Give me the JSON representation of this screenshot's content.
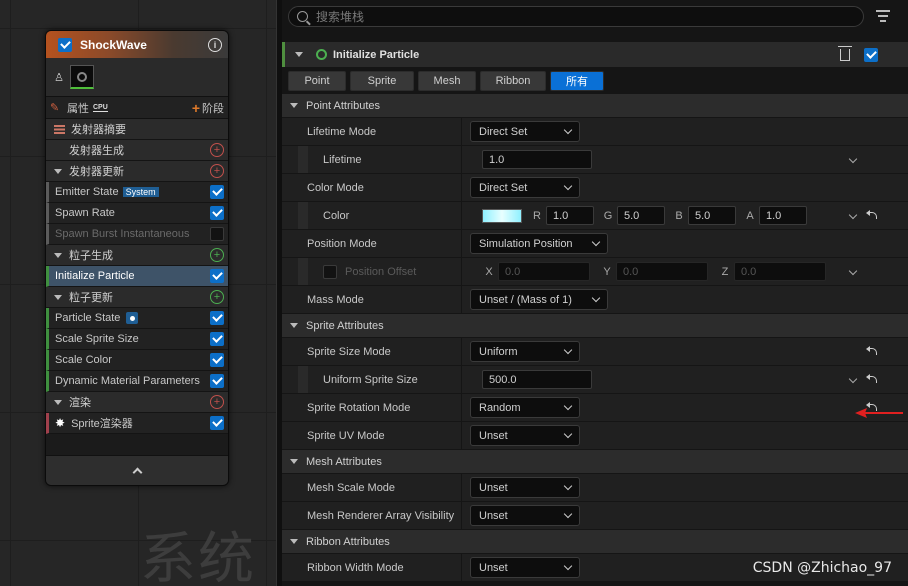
{
  "graph": {
    "watermark": "系统"
  },
  "node": {
    "title": "ShockWave",
    "tabs": {
      "properties_label": "属性",
      "cpu_badge": "CPU",
      "stage_label": "阶段"
    },
    "rows": [
      {
        "type": "section",
        "label": "发射器摘要",
        "icon": "list-icon"
      },
      {
        "type": "section-plus",
        "label": "发射器生成",
        "plus": "red"
      },
      {
        "type": "section-plus",
        "label": "发射器更新",
        "plus": "red",
        "collapsible": true
      },
      {
        "type": "item",
        "label": "Emitter State",
        "badge": "System",
        "checked": true,
        "bar": "gray"
      },
      {
        "type": "item",
        "label": "Spawn Rate",
        "checked": true,
        "bar": "gray"
      },
      {
        "type": "item",
        "label": "Spawn Burst Instantaneous",
        "checked": false,
        "bar": "gray",
        "dim": true
      },
      {
        "type": "section-plus",
        "label": "粒子生成",
        "plus": "green",
        "collapsible": true
      },
      {
        "type": "item",
        "label": "Initialize Particle",
        "checked": true,
        "bar": "green",
        "selected": true
      },
      {
        "type": "section-plus",
        "label": "粒子更新",
        "plus": "green",
        "collapsible": true
      },
      {
        "type": "item",
        "label": "Particle State",
        "dotbadge": true,
        "checked": true,
        "bar": "green"
      },
      {
        "type": "item",
        "label": "Scale Sprite Size",
        "checked": true,
        "bar": "green"
      },
      {
        "type": "item",
        "label": "Scale Color",
        "checked": true,
        "bar": "green"
      },
      {
        "type": "item",
        "label": "Dynamic Material Parameters",
        "checked": true,
        "bar": "green"
      },
      {
        "type": "section-plus",
        "label": "渲染",
        "plus": "red",
        "collapsible": true
      },
      {
        "type": "item",
        "label": "Sprite渲染器",
        "burst": true,
        "checked": true,
        "bar": "red"
      }
    ]
  },
  "panel": {
    "search_placeholder": "搜索堆栈",
    "module_title": "Initialize Particle",
    "tabs": [
      "Point",
      "Sprite",
      "Mesh",
      "Ribbon",
      "所有"
    ],
    "active_tab": 4,
    "rows": [
      {
        "kind": "cat",
        "label": "Point Attributes"
      },
      {
        "kind": "combo",
        "label": "Lifetime Mode",
        "value": "Direct Set",
        "w": 110
      },
      {
        "kind": "num",
        "label": "Lifetime",
        "value": "1.0",
        "sub": true,
        "expand": true
      },
      {
        "kind": "combo",
        "label": "Color Mode",
        "value": "Direct Set",
        "w": 110
      },
      {
        "kind": "color",
        "label": "Color",
        "sub": true,
        "expand": true,
        "reset": true,
        "channels": [
          {
            "k": "R",
            "v": "1.0"
          },
          {
            "k": "G",
            "v": "5.0"
          },
          {
            "k": "B",
            "v": "5.0"
          },
          {
            "k": "A",
            "v": "1.0"
          }
        ]
      },
      {
        "kind": "combo",
        "label": "Position Mode",
        "value": "Simulation Position",
        "w": 138
      },
      {
        "kind": "vec",
        "label": "Position Offset",
        "sub": true,
        "dim": true,
        "check": true,
        "expand": true,
        "channels": [
          {
            "k": "X",
            "v": "0.0"
          },
          {
            "k": "Y",
            "v": "0.0"
          },
          {
            "k": "Z",
            "v": "0.0"
          }
        ]
      },
      {
        "kind": "combo",
        "label": "Mass Mode",
        "value": "Unset / (Mass of 1)",
        "w": 138
      },
      {
        "kind": "cat",
        "label": "Sprite Attributes"
      },
      {
        "kind": "combo",
        "label": "Sprite Size Mode",
        "value": "Uniform",
        "w": 110,
        "reset": true
      },
      {
        "kind": "num",
        "label": "Uniform Sprite Size",
        "value": "500.0",
        "sub": true,
        "expand": true,
        "reset": true
      },
      {
        "kind": "combo",
        "label": "Sprite Rotation Mode",
        "value": "Random",
        "w": 110,
        "reset": true
      },
      {
        "kind": "combo",
        "label": "Sprite UV Mode",
        "value": "Unset",
        "w": 110
      },
      {
        "kind": "cat",
        "label": "Mesh Attributes"
      },
      {
        "kind": "combo",
        "label": "Mesh Scale Mode",
        "value": "Unset",
        "w": 110
      },
      {
        "kind": "combo",
        "label": "Mesh Renderer Array Visibility",
        "value": "Unset",
        "w": 110
      },
      {
        "kind": "cat",
        "label": "Ribbon Attributes"
      },
      {
        "kind": "combo",
        "label": "Ribbon Width Mode",
        "value": "Unset",
        "w": 110
      }
    ]
  },
  "watermark": "CSDN @Zhichao_97",
  "colors": {
    "accent": "#0a70d6",
    "annotation_arrow": "#e02020",
    "node_header": "#b5521f"
  }
}
